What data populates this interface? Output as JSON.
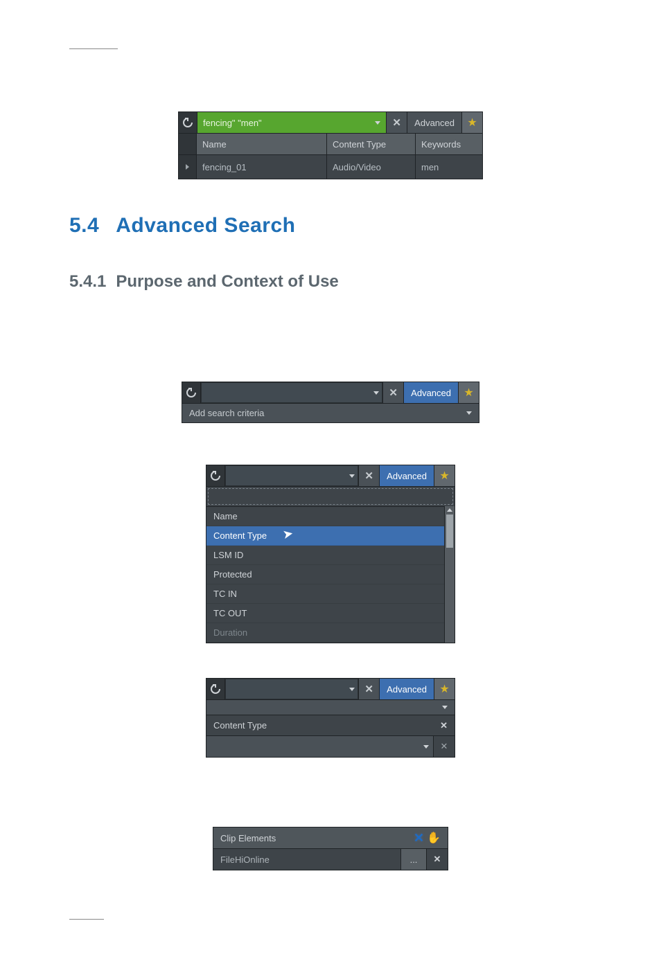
{
  "heading1": {
    "num": "5.4",
    "text": "Advanced Search"
  },
  "heading2": {
    "num": "5.4.1",
    "text": "Purpose and Context of Use"
  },
  "fig1": {
    "search_value": "fencing\" \"men\"",
    "advanced_label": "Advanced",
    "headers": [
      "Name",
      "Content Type",
      "Keywords"
    ],
    "row": [
      "fencing_01",
      "Audio/Video",
      "men"
    ]
  },
  "fig2": {
    "advanced_label": "Advanced",
    "criteria_prompt": "Add search criteria"
  },
  "fig3": {
    "advanced_label": "Advanced",
    "items": [
      "Name",
      "Content Type",
      "LSM ID",
      "Protected",
      "TC IN",
      "TC OUT",
      "Duration"
    ],
    "highlight_index": 1,
    "dim_index": 6
  },
  "fig4": {
    "advanced_label": "Advanced",
    "criterion_label": "Content Type"
  },
  "fig5": {
    "group_label": "Clip Elements",
    "field_label": "FileHiOnline",
    "dots": "..."
  }
}
